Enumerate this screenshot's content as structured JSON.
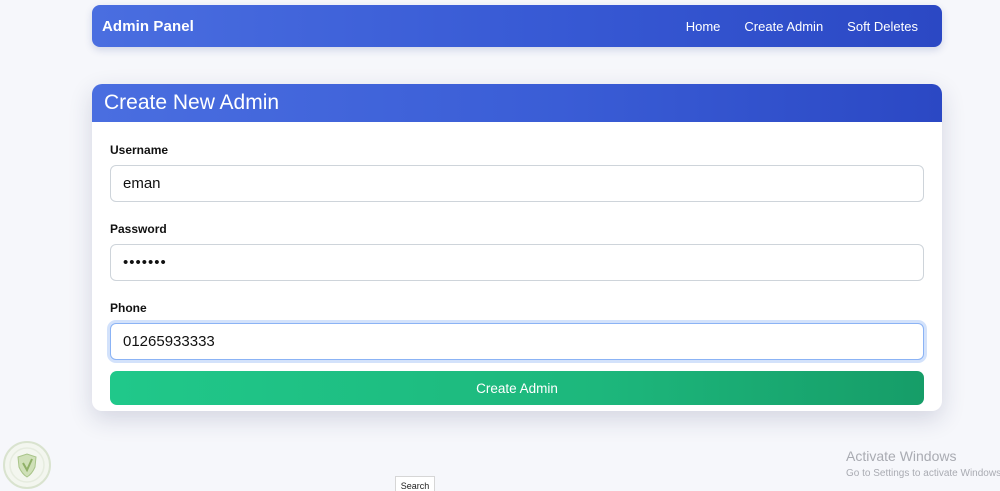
{
  "navbar": {
    "brand": "Admin Panel",
    "links": [
      "Home",
      "Create Admin",
      "Soft Deletes"
    ]
  },
  "form": {
    "title": "Create New Admin",
    "username": {
      "label": "Username",
      "value": "eman"
    },
    "password": {
      "label": "Password",
      "value": "•••••••"
    },
    "phone": {
      "label": "Phone",
      "value": "01265933333"
    },
    "submit_label": "Create Admin"
  },
  "overlay": {
    "activate_title": "Activate Windows",
    "activate_subtitle": "Go to Settings to activate Windows.",
    "search_label": "Search"
  },
  "colors": {
    "primary": "#3759d4",
    "success": "#1db77c",
    "background": "#f6f7fb"
  }
}
